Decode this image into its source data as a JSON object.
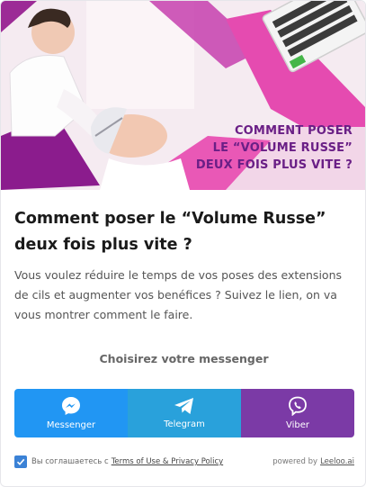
{
  "hero": {
    "title_lines": [
      "COMMENT POSER",
      "LE “VOLUME RUSSE”",
      "DEUX FOIS PLUS VITE ?"
    ]
  },
  "card": {
    "title": "Comment poser le “Volume Russe” deux fois plus vite ?",
    "description": "Vous voulez réduire le temps de vos poses des extensions de cils et augmenter vos benéfices ? Suivez le lien, on va vous montrer comment le faire.",
    "prompt": "Choisirez votre messenger"
  },
  "messengers": [
    {
      "label": "Messenger",
      "icon": "messenger-icon",
      "color": "#2196f3"
    },
    {
      "label": "Telegram",
      "icon": "telegram-icon",
      "color": "#29a1db"
    },
    {
      "label": "Viber",
      "icon": "viber-icon",
      "color": "#7b3aa6"
    }
  ],
  "footer": {
    "consent": "Вы соглашаетесь с",
    "terms_link": "Terms of Use & Privacy Policy",
    "powered_by": "powered by",
    "brand": "Leeloo.ai"
  },
  "colors": {
    "accent_purple": "#6a1f86",
    "pink": "#e63ca0",
    "check_blue": "#3b82d6"
  }
}
